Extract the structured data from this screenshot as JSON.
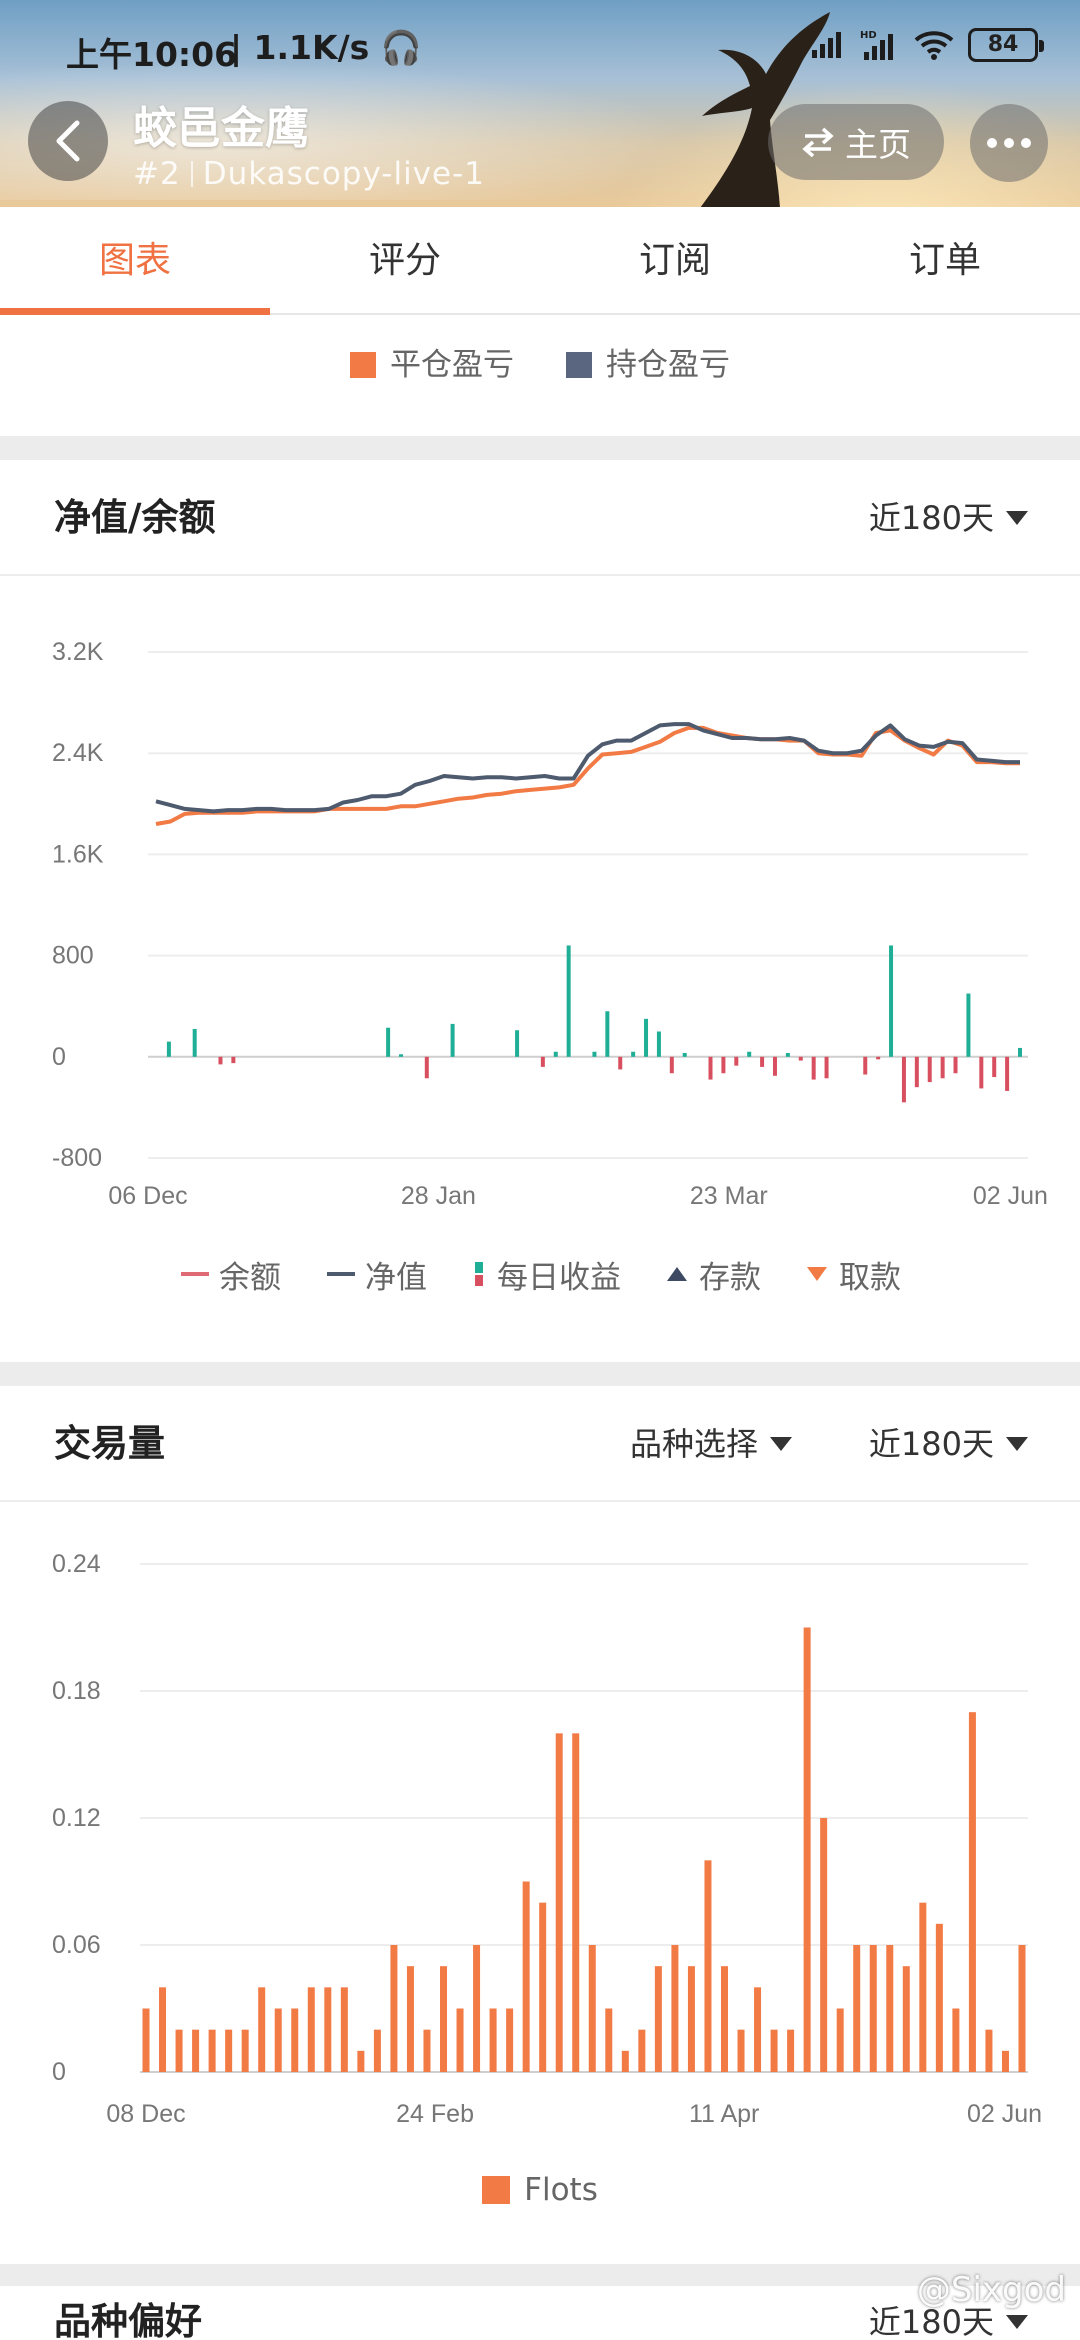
{
  "status_bar": {
    "time": "上午10:06",
    "network_speed": "1.1K/s",
    "battery": "84"
  },
  "header": {
    "title": "蛟邑金鹰",
    "rank": "#2",
    "account": "Dukascopy-live-1",
    "home_label": "主页"
  },
  "tabs": [
    {
      "label": "图表",
      "active": true
    },
    {
      "label": "评分",
      "active": false
    },
    {
      "label": "订阅",
      "active": false
    },
    {
      "label": "订单",
      "active": false
    }
  ],
  "pnl_legend": [
    {
      "label": "平仓盈亏",
      "color": "#f27a45"
    },
    {
      "label": "持仓盈亏",
      "color": "#5a6680"
    }
  ],
  "equity_section": {
    "title": "净值/余额",
    "range_label": "近180天",
    "legend": [
      {
        "label": "余额",
        "color": "#e06a74",
        "marker": "line"
      },
      {
        "label": "净值",
        "color": "#4e5a6e",
        "marker": "line"
      },
      {
        "label": "每日收益",
        "color": "#1fae96",
        "marker": "bar"
      },
      {
        "label": "存款",
        "color": "#3e4a63",
        "marker": "triangle-up"
      },
      {
        "label": "取款",
        "color": "#f27a45",
        "marker": "triangle-down"
      }
    ]
  },
  "volume_section": {
    "title": "交易量",
    "symbol_label": "品种选择",
    "range_label": "近180天",
    "legend": [
      {
        "label": "Flots",
        "color": "#f27a45"
      }
    ]
  },
  "next_section": {
    "title": "品种偏好",
    "range_label": "近180天"
  },
  "watermark": "@Sixgod",
  "chart_data": [
    {
      "type": "line",
      "name": "equity-balance",
      "x_ticks": [
        "06 Dec",
        "28 Jan",
        "23 Mar",
        "02 Jun"
      ],
      "y_ticks": [
        "3.2K",
        "2.4K",
        "1.6K",
        "800",
        "0",
        "-800"
      ],
      "ylim": [
        -800,
        3200
      ],
      "grid": true,
      "legend_position": "bottom",
      "series": [
        {
          "name": "余额",
          "color": "#f27a45",
          "values": [
            1840,
            1860,
            1920,
            1930,
            1930,
            1930,
            1930,
            1940,
            1940,
            1940,
            1940,
            1940,
            1960,
            1960,
            1960,
            1960,
            1960,
            1980,
            1980,
            2000,
            2020,
            2040,
            2050,
            2070,
            2080,
            2100,
            2110,
            2120,
            2130,
            2150,
            2280,
            2390,
            2400,
            2410,
            2450,
            2490,
            2560,
            2600,
            2600,
            2560,
            2540,
            2520,
            2510,
            2510,
            2500,
            2500,
            2400,
            2390,
            2390,
            2380,
            2560,
            2580,
            2500,
            2440,
            2390,
            2500,
            2460,
            2330,
            2330,
            2320,
            2320
          ]
        },
        {
          "name": "净值",
          "color": "#4e5a6e",
          "values": [
            2020,
            1990,
            1960,
            1950,
            1940,
            1950,
            1950,
            1960,
            1960,
            1950,
            1950,
            1950,
            1960,
            2010,
            2030,
            2060,
            2060,
            2080,
            2150,
            2180,
            2220,
            2210,
            2200,
            2210,
            2210,
            2200,
            2210,
            2220,
            2200,
            2200,
            2380,
            2470,
            2500,
            2500,
            2560,
            2620,
            2630,
            2630,
            2580,
            2550,
            2520,
            2520,
            2510,
            2510,
            2520,
            2500,
            2420,
            2400,
            2400,
            2420,
            2540,
            2620,
            2510,
            2460,
            2450,
            2490,
            2480,
            2350,
            2340,
            2330,
            2330
          ]
        },
        {
          "name": "每日收益",
          "color": "#1fae96",
          "negative_color": "#d8505f",
          "values": [
            0,
            120,
            0,
            220,
            0,
            -60,
            -50,
            0,
            0,
            0,
            0,
            0,
            0,
            0,
            0,
            0,
            0,
            0,
            230,
            20,
            0,
            -170,
            0,
            260,
            0,
            0,
            0,
            0,
            210,
            0,
            -80,
            40,
            880,
            0,
            40,
            360,
            -100,
            40,
            300,
            200,
            -130,
            30,
            0,
            -180,
            -130,
            -70,
            40,
            -80,
            -150,
            30,
            -30,
            -180,
            -170,
            0,
            0,
            -140,
            -20,
            880,
            -360,
            -240,
            -200,
            -170,
            -130,
            500,
            -250,
            -160,
            -270,
            70
          ]
        }
      ]
    },
    {
      "type": "bar",
      "name": "volume",
      "x_ticks": [
        "08 Dec",
        "24 Feb",
        "11 Apr",
        "02 Jun"
      ],
      "y_ticks": [
        "0.24",
        "0.18",
        "0.12",
        "0.06",
        "0"
      ],
      "ylim": [
        0,
        0.24
      ],
      "grid": true,
      "legend_position": "bottom",
      "series": [
        {
          "name": "Flots",
          "color": "#f27a45",
          "values": [
            0.03,
            0.04,
            0.02,
            0.02,
            0.02,
            0.02,
            0.02,
            0.04,
            0.03,
            0.03,
            0.04,
            0.04,
            0.04,
            0.01,
            0.02,
            0.06,
            0.05,
            0.02,
            0.05,
            0.03,
            0.06,
            0.03,
            0.03,
            0.09,
            0.08,
            0.16,
            0.16,
            0.06,
            0.03,
            0.01,
            0.02,
            0.05,
            0.06,
            0.05,
            0.1,
            0.05,
            0.02,
            0.04,
            0.02,
            0.02,
            0.21,
            0.12,
            0.03,
            0.06,
            0.06,
            0.06,
            0.05,
            0.08,
            0.07,
            0.03,
            0.17,
            0.02,
            0.01,
            0.06
          ]
        }
      ]
    }
  ]
}
